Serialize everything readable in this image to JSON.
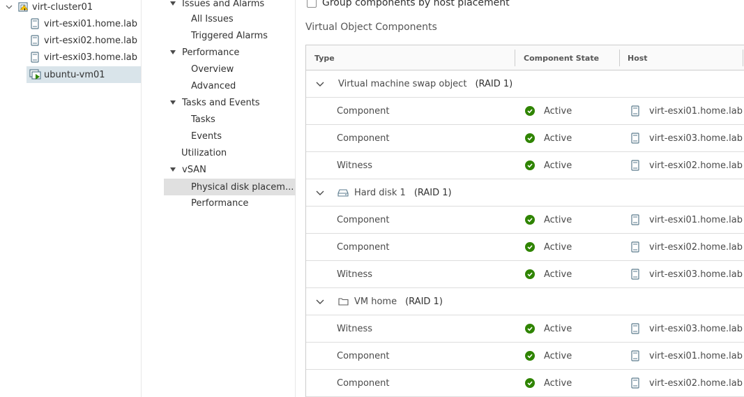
{
  "tree": {
    "items": [
      {
        "label": "virt-cluster01"
      },
      {
        "label": "virt-esxi01.home.lab"
      },
      {
        "label": "virt-esxi02.home.lab"
      },
      {
        "label": "virt-esxi03.home.lab"
      },
      {
        "label": "ubuntu-vm01"
      }
    ]
  },
  "nav": {
    "items": [
      {
        "label": "Issues and Alarms"
      },
      {
        "label": "All Issues"
      },
      {
        "label": "Triggered Alarms"
      },
      {
        "label": "Performance"
      },
      {
        "label": "Overview"
      },
      {
        "label": "Advanced"
      },
      {
        "label": "Tasks and Events"
      },
      {
        "label": "Tasks"
      },
      {
        "label": "Events"
      },
      {
        "label": "Utilization"
      },
      {
        "label": "vSAN"
      },
      {
        "label": "Physical disk placem..."
      },
      {
        "label": "Performance"
      }
    ]
  },
  "main": {
    "group_checkbox_label": "Group components by host placement",
    "section_title": "Virtual Object Components",
    "columns": [
      "Type",
      "Component State",
      "Host"
    ],
    "groups": [
      {
        "name": "Virtual machine swap object",
        "raid": "(RAID 1)",
        "icon": "none",
        "rows": [
          {
            "type": "Component",
            "state": "Active",
            "host": "virt-esxi01.home.lab"
          },
          {
            "type": "Component",
            "state": "Active",
            "host": "virt-esxi03.home.lab"
          },
          {
            "type": "Witness",
            "state": "Active",
            "host": "virt-esxi02.home.lab"
          }
        ]
      },
      {
        "name": "Hard disk 1",
        "raid": "(RAID 1)",
        "icon": "hard-disk-icon",
        "rows": [
          {
            "type": "Component",
            "state": "Active",
            "host": "virt-esxi01.home.lab"
          },
          {
            "type": "Component",
            "state": "Active",
            "host": "virt-esxi02.home.lab"
          },
          {
            "type": "Witness",
            "state": "Active",
            "host": "virt-esxi03.home.lab"
          }
        ]
      },
      {
        "name": "VM home",
        "raid": "(RAID 1)",
        "icon": "folder-icon",
        "rows": [
          {
            "type": "Witness",
            "state": "Active",
            "host": "virt-esxi03.home.lab"
          },
          {
            "type": "Component",
            "state": "Active",
            "host": "virt-esxi01.home.lab"
          },
          {
            "type": "Component",
            "state": "Active",
            "host": "virt-esxi02.home.lab"
          }
        ]
      }
    ]
  },
  "colors": {
    "active_green": "#2f8400",
    "selected_tree": "#d9e4ea",
    "selected_nav": "#e0e0e0"
  }
}
